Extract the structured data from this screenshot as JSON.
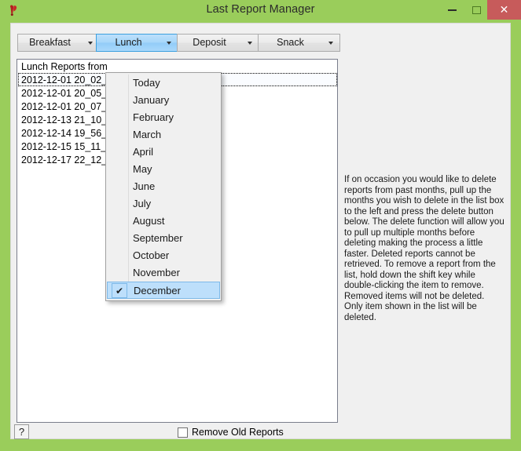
{
  "window": {
    "title": "Last Report Manager",
    "icon": "app-icon",
    "frame_color": "#9ACD5B",
    "client_color": "#F0F0F0",
    "controls": {
      "minimize": "minimize",
      "maximize": "maximize",
      "close": "✕"
    }
  },
  "toolbar": {
    "accent_color": "#A6D6FA",
    "buttons": [
      {
        "label": "Breakfast",
        "active": false
      },
      {
        "label": "Lunch",
        "active": true
      },
      {
        "label": "Deposit",
        "active": false
      },
      {
        "label": "Snack",
        "active": false
      }
    ]
  },
  "listbox": {
    "header": "Lunch Reports from",
    "items": [
      "2012-12-01 20_02_3",
      "2012-12-01 20_05_5",
      "2012-12-01 20_07_0",
      "2012-12-13 21_10_3",
      "2012-12-14 19_56_0",
      "2012-12-15 15_11_0",
      "2012-12-17 22_12_3"
    ],
    "focused_index": 0
  },
  "dropdown": {
    "open": true,
    "owner": "Lunch",
    "selected": "December",
    "items": [
      {
        "label": "Today",
        "checked": false
      },
      {
        "label": "January",
        "checked": false
      },
      {
        "label": "February",
        "checked": false
      },
      {
        "label": "March",
        "checked": false
      },
      {
        "label": "April",
        "checked": false
      },
      {
        "label": "May",
        "checked": false
      },
      {
        "label": "June",
        "checked": false
      },
      {
        "label": "July",
        "checked": false
      },
      {
        "label": "August",
        "checked": false
      },
      {
        "label": "September",
        "checked": false
      },
      {
        "label": "October",
        "checked": false
      },
      {
        "label": "November",
        "checked": false
      },
      {
        "label": "December",
        "checked": true
      }
    ],
    "check_glyph": "✔"
  },
  "instructions": {
    "text": "If on occasion you would like to delete reports from past months, pull up the months you wish to delete in the list box to the left and press the delete button below. The delete function will allow you to pull up multiple months before deleting making the process a little faster. Deleted reports cannot be retrieved. To remove a report from the list, hold down the shift key while double-clicking the item to remove. Removed items will not be deleted. Only item shown in the list will be deleted."
  },
  "footer": {
    "help_glyph": "?",
    "remove_old_reports_label": "Remove Old Reports",
    "remove_old_reports_checked": false
  }
}
